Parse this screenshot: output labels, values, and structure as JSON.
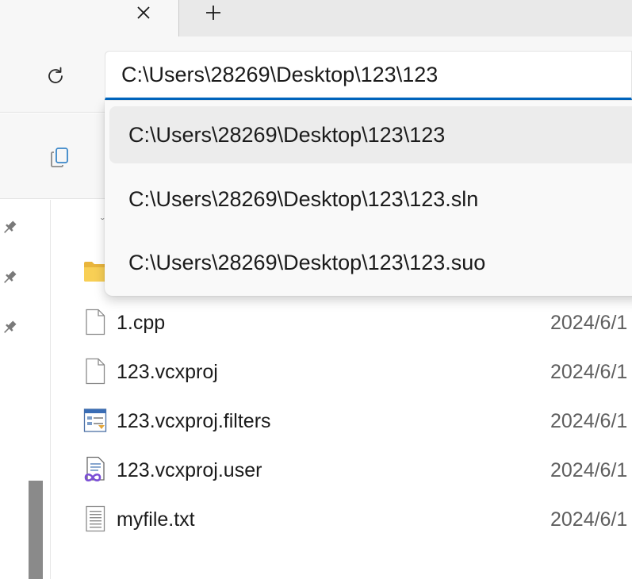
{
  "tabs": {
    "close_glyph": "×",
    "new_tab_glyph": "+"
  },
  "address_bar": {
    "value": "C:\\Users\\28269\\Desktop\\123\\123",
    "accent_color": "#0067c0"
  },
  "autocomplete": {
    "items": [
      {
        "label": "C:\\Users\\28269\\Desktop\\123\\123",
        "selected": true
      },
      {
        "label": "C:\\Users\\28269\\Desktop\\123\\123.sln",
        "selected": false
      },
      {
        "label": "C:\\Users\\28269\\Desktop\\123\\123.suo",
        "selected": false
      }
    ]
  },
  "icons": {
    "tab_close": "close-icon",
    "tab_new": "plus-icon",
    "refresh": "refresh-icon",
    "copy": "copy-icon",
    "pin": "pin-icon",
    "folder": "folder-icon"
  },
  "nav_pane": {
    "pinned_count": 3
  },
  "files": [
    {
      "name": "1.cpp",
      "date": "2024/6/1",
      "icon": "blank-file-icon"
    },
    {
      "name": "123.vcxproj",
      "date": "2024/6/1",
      "icon": "blank-file-icon"
    },
    {
      "name": "123.vcxproj.filters",
      "date": "2024/6/1",
      "icon": "vs-filters-file-icon"
    },
    {
      "name": "123.vcxproj.user",
      "date": "2024/6/1",
      "icon": "vs-user-file-icon"
    },
    {
      "name": "myfile.txt",
      "date": "2024/6/1",
      "icon": "text-file-icon"
    }
  ]
}
